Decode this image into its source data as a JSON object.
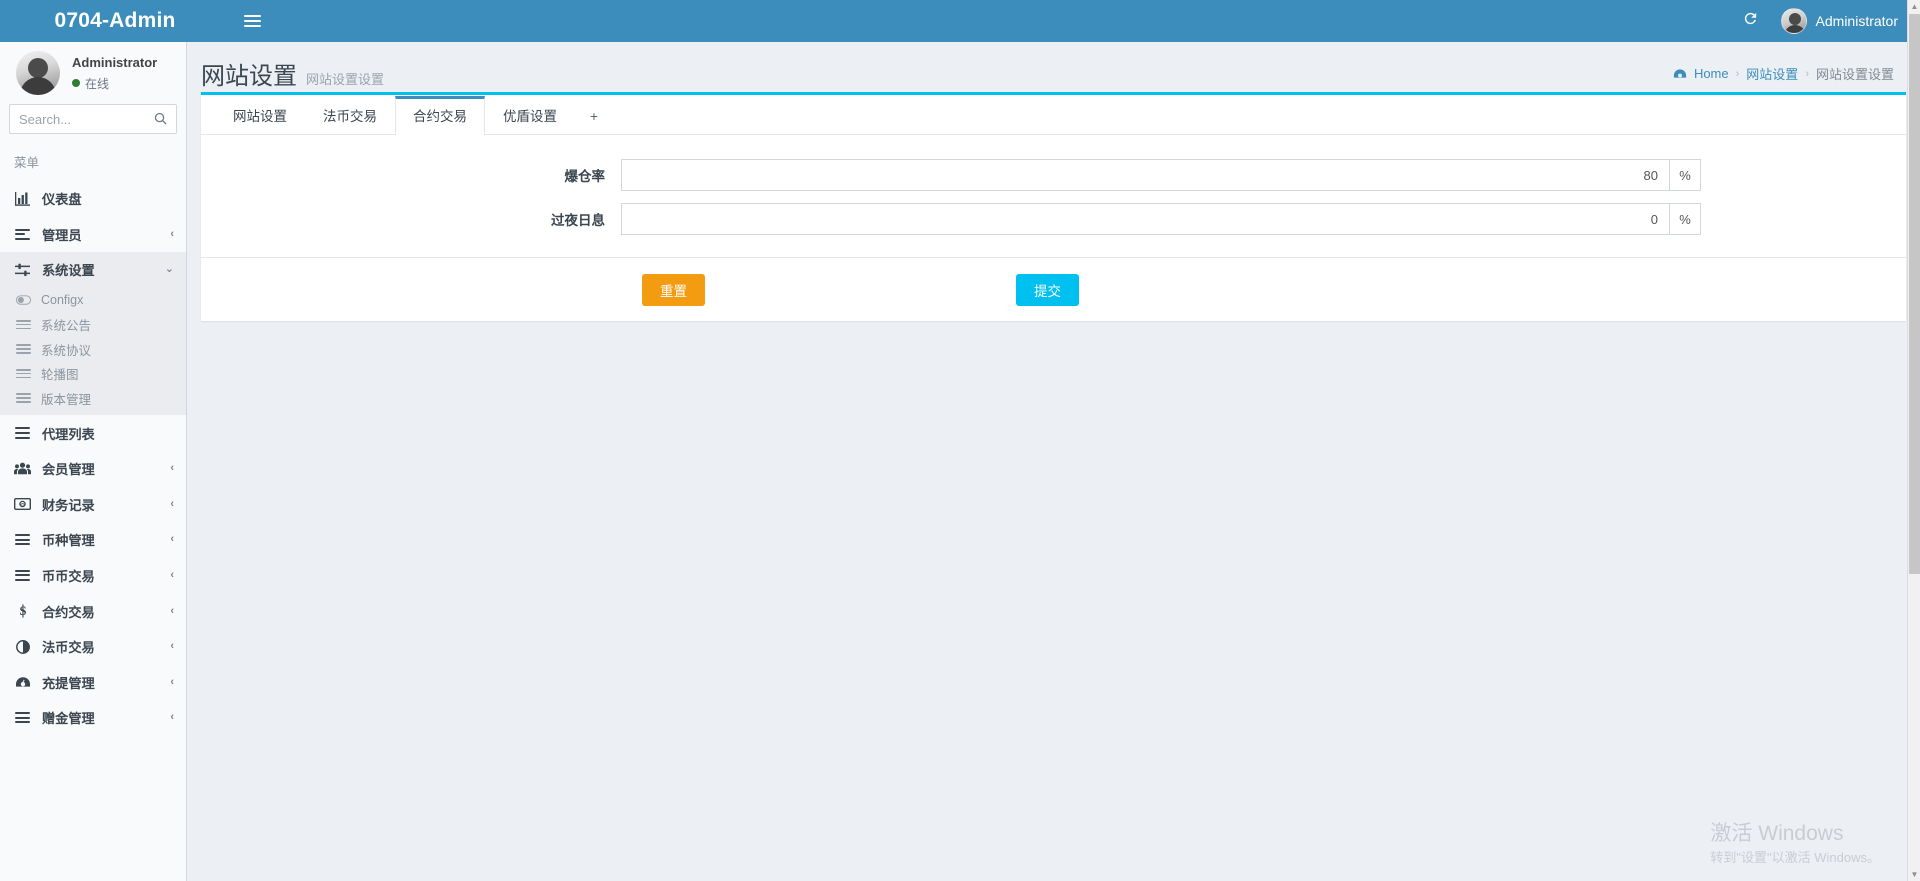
{
  "topbar": {
    "brand": "0704-Admin",
    "menu_toggle_name": "hamburger",
    "refresh_icon": "refresh-icon",
    "user_label": "Administrator"
  },
  "sidebar": {
    "user": {
      "name": "Administrator",
      "status": "在线"
    },
    "search": {
      "placeholder": "Search...",
      "value": "",
      "icon": "search-icon"
    },
    "menu_header": "菜单",
    "items": [
      {
        "label": "仪表盘",
        "icon": "chart-bar-icon",
        "caret": "",
        "active": false
      },
      {
        "label": "管理员",
        "icon": "list-icon",
        "caret": "‹",
        "active": false
      },
      {
        "label": "系统设置",
        "icon": "sliders-icon",
        "caret": "⌄",
        "active": true
      }
    ],
    "subitems": [
      {
        "label": "Configx",
        "icon": "toggle-icon"
      },
      {
        "label": "系统公告",
        "icon": "bars-icon"
      },
      {
        "label": "系统协议",
        "icon": "bars-icon"
      },
      {
        "label": "轮播图",
        "icon": "bars-icon"
      },
      {
        "label": "版本管理",
        "icon": "bars-icon"
      }
    ],
    "items2": [
      {
        "label": "代理列表",
        "icon": "bars-icon",
        "caret": ""
      },
      {
        "label": "会员管理",
        "icon": "users-icon",
        "caret": "‹"
      },
      {
        "label": "财务记录",
        "icon": "money-icon",
        "caret": "‹"
      },
      {
        "label": "币种管理",
        "icon": "bars-icon",
        "caret": "‹"
      },
      {
        "label": "币币交易",
        "icon": "bars-icon",
        "caret": "‹"
      },
      {
        "label": "合约交易",
        "icon": "dollar-icon",
        "caret": "‹"
      },
      {
        "label": "法币交易",
        "icon": "contrast-icon",
        "caret": "‹"
      },
      {
        "label": "充提管理",
        "icon": "dashboard-icon",
        "caret": "‹"
      },
      {
        "label": "赠金管理",
        "icon": "bars-icon",
        "caret": "‹"
      }
    ]
  },
  "page": {
    "title": "网站设置",
    "subtitle": "网站设置设置",
    "breadcrumb": {
      "home_icon": "dashboard-icon",
      "home": "Home",
      "sep": "›",
      "level2": "网站设置",
      "current": "网站设置设置"
    }
  },
  "tabs": [
    {
      "label": "网站设置",
      "active": false
    },
    {
      "label": "法币交易",
      "active": false
    },
    {
      "label": "合约交易",
      "active": true
    },
    {
      "label": "优盾设置",
      "active": false
    },
    {
      "label": "+",
      "active": false
    }
  ],
  "form": {
    "fields": [
      {
        "label": "爆仓率",
        "value": "80",
        "addon": "%",
        "placeholder": ""
      },
      {
        "label": "过夜日息",
        "value": "0",
        "addon": "%",
        "placeholder": ""
      }
    ],
    "reset_label": "重置",
    "submit_label": "提交"
  },
  "watermark": {
    "line1": "激活 Windows",
    "line2": "转到\"设置\"以激活 Windows。"
  },
  "colors": {
    "header_blue": "#3c8dbc",
    "card_accent": "#00c0ef",
    "tab_active": "#3c8dbc",
    "reset_orange": "#f39c12",
    "submit_cyan": "#00c0ef",
    "body_bg": "#ecf0f5",
    "sidebar_bg": "#f9fafc",
    "online_green": "#2f7d32"
  }
}
